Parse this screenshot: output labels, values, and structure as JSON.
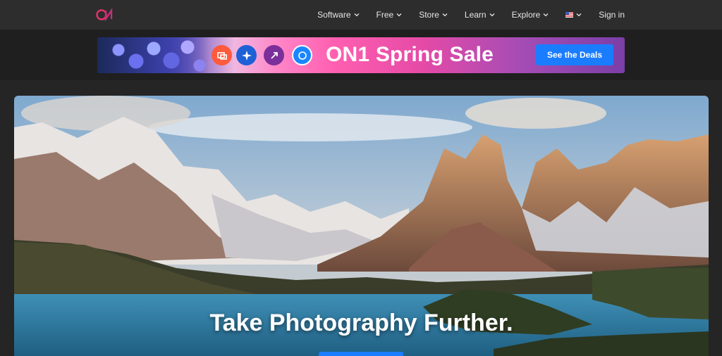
{
  "nav": {
    "items": [
      {
        "label": "Software"
      },
      {
        "label": "Free"
      },
      {
        "label": "Store"
      },
      {
        "label": "Learn"
      },
      {
        "label": "Explore"
      }
    ],
    "sign_in": "Sign in",
    "language_flag": "us-flag-icon"
  },
  "banner": {
    "title": "ON1 Spring Sale",
    "cta": "See the Deals",
    "icons": [
      "resize-icon",
      "effects-icon",
      "upscale-icon",
      "on1-photo-raw-icon"
    ]
  },
  "hero": {
    "title": "Take Photography Further."
  },
  "colors": {
    "nav_bg": "#2d2d2d",
    "page_bg": "#252525",
    "accent_blue": "#1a7dff",
    "logo_pink": "#e6336b"
  }
}
